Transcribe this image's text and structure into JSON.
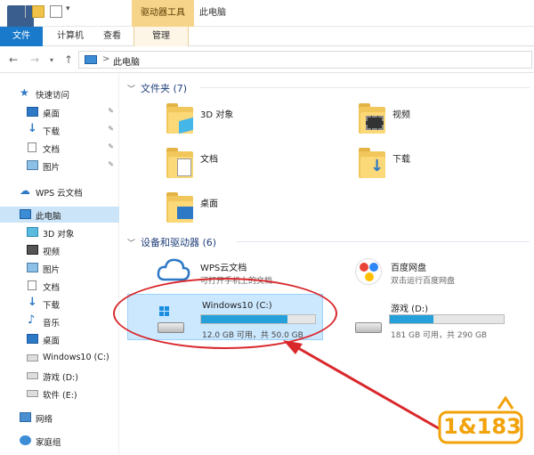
{
  "titlebar": {
    "context_tab": "驱动器工具",
    "window_title": "此电脑"
  },
  "ribbon": {
    "tabs": [
      "文件",
      "计算机",
      "查看",
      "管理"
    ]
  },
  "address": {
    "crumb": "此电脑",
    "separator": ">"
  },
  "sidebar": {
    "quick_access": "快速访问",
    "items": [
      "桌面",
      "下载",
      "文档",
      "图片"
    ],
    "wps": "WPS 云文档",
    "this_pc": "此电脑",
    "pc_items": [
      "3D 对象",
      "视频",
      "图片",
      "文档",
      "下载",
      "音乐",
      "桌面",
      "Windows10 (C:)",
      "游戏 (D:)",
      "软件 (E:)"
    ],
    "network": "网络",
    "homegroup": "家庭组"
  },
  "folders_group": {
    "header": "文件夹 (7)",
    "items": [
      "3D 对象",
      "视频",
      "文档",
      "下载",
      "桌面"
    ]
  },
  "devices_group": {
    "header": "设备和驱动器 (6)",
    "wps_title": "WPS云文档",
    "wps_sub": "可打开手机上的文档",
    "baidu_title": "百度网盘",
    "baidu_sub": "双击运行百度网盘",
    "drive_c": {
      "name": "Windows10 (C:)",
      "space": "12.0 GB 可用，共 50.0 GB",
      "used_fraction": 0.76
    },
    "drive_d": {
      "name": "游戏 (D:)",
      "space": "181 GB 可用，共 290 GB",
      "used_fraction": 0.38
    }
  },
  "watermark": "1&183",
  "colors": {
    "accent": "#1979ca",
    "highlight": "#d9282c",
    "folder": "#f1c65a"
  }
}
